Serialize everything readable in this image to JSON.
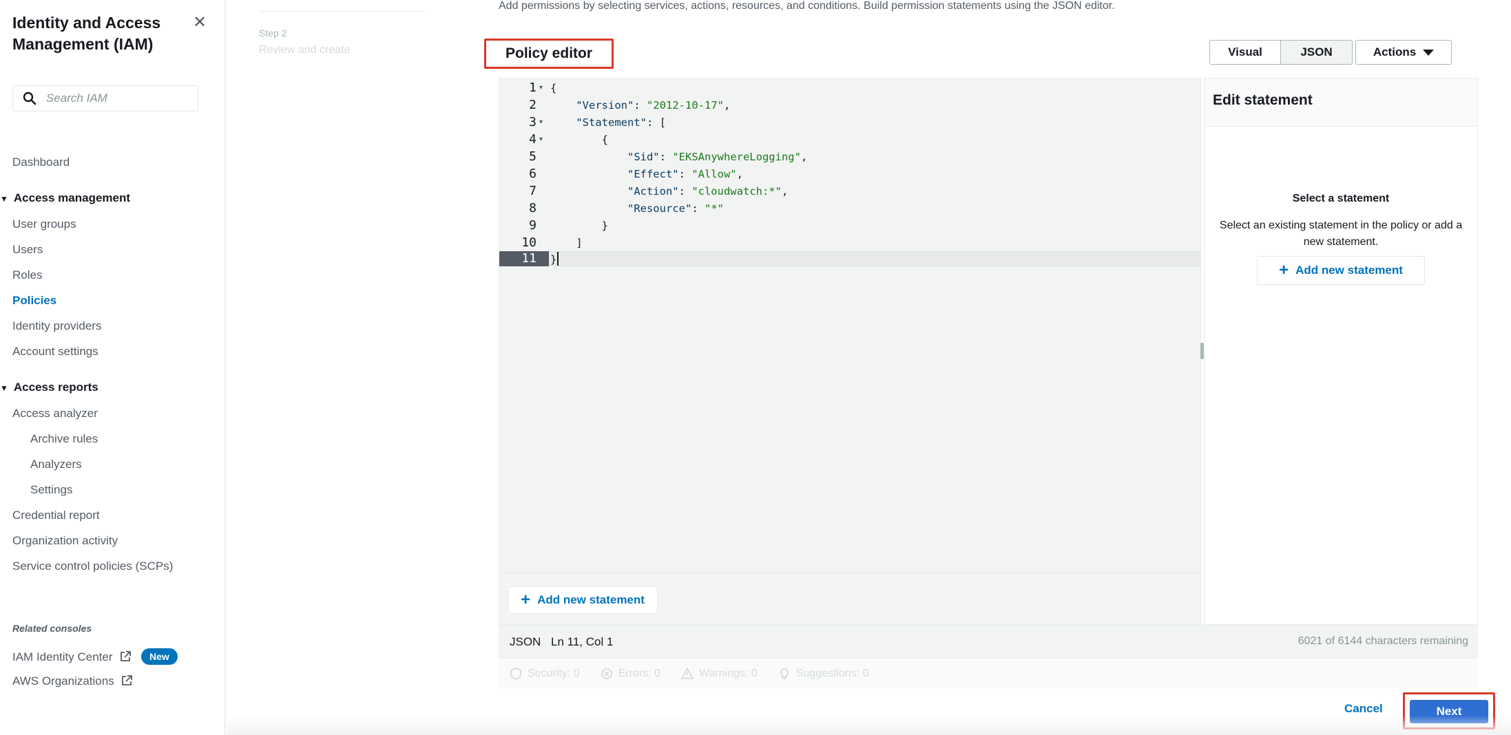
{
  "sidebar": {
    "title": "Identity and Access Management (IAM)",
    "search_placeholder": "Search IAM",
    "dashboard": "Dashboard",
    "section_access_management": "Access management",
    "user_groups": "User groups",
    "users": "Users",
    "roles": "Roles",
    "policies": "Policies",
    "identity_providers": "Identity providers",
    "account_settings": "Account settings",
    "section_access_reports": "Access reports",
    "access_analyzer": "Access analyzer",
    "archive_rules": "Archive rules",
    "analyzers": "Analyzers",
    "settings": "Settings",
    "credential_report": "Credential report",
    "organization_activity": "Organization activity",
    "scps": "Service control policies (SCPs)",
    "related_consoles": "Related consoles",
    "iam_identity_center": "IAM Identity Center",
    "new_badge": "New",
    "aws_organizations": "AWS Organizations",
    "active_color": "#0073bb"
  },
  "steps": {
    "step_number": "Step 2",
    "step_label": "Review and create"
  },
  "main": {
    "intro": "Add permissions by selecting services, actions, resources, and conditions. Build permission statements using the JSON editor.",
    "policy_editor_title": "Policy editor",
    "toggle_visual": "Visual",
    "toggle_json": "JSON",
    "actions_label": "Actions"
  },
  "editor": {
    "line_numbers": [
      "1",
      "2",
      "3",
      "4",
      "5",
      "6",
      "7",
      "8",
      "9",
      "10",
      "11"
    ],
    "version_key": "\"Version\"",
    "version_val": "\"2012-10-17\"",
    "statement_key": "\"Statement\"",
    "sid_key": "\"Sid\"",
    "sid_val": "\"EKSAnywhereLogging\"",
    "effect_key": "\"Effect\"",
    "effect_val": "\"Allow\"",
    "action_key": "\"Action\"",
    "action_val": "\"cloudwatch:*\"",
    "resource_key": "\"Resource\"",
    "resource_val": "\"*\"",
    "add_statement": "Add new statement"
  },
  "edit_panel": {
    "title": "Edit statement",
    "select_title": "Select a statement",
    "select_desc": "Select an existing statement in the policy or add a new statement.",
    "add_statement": "Add new statement"
  },
  "status": {
    "mode": "JSON",
    "position": "Ln 11, Col 1",
    "remaining": "6021 of 6144 characters remaining",
    "security": "Security: 0",
    "errors": "Errors: 0",
    "warnings": "Warnings: 0",
    "suggestions": "Suggestions: 0"
  },
  "footer": {
    "cancel": "Cancel",
    "next": "Next"
  },
  "colors": {
    "highlight_border": "#d93a27",
    "primary_button": "#2f6fd1",
    "link": "#0073bb"
  }
}
